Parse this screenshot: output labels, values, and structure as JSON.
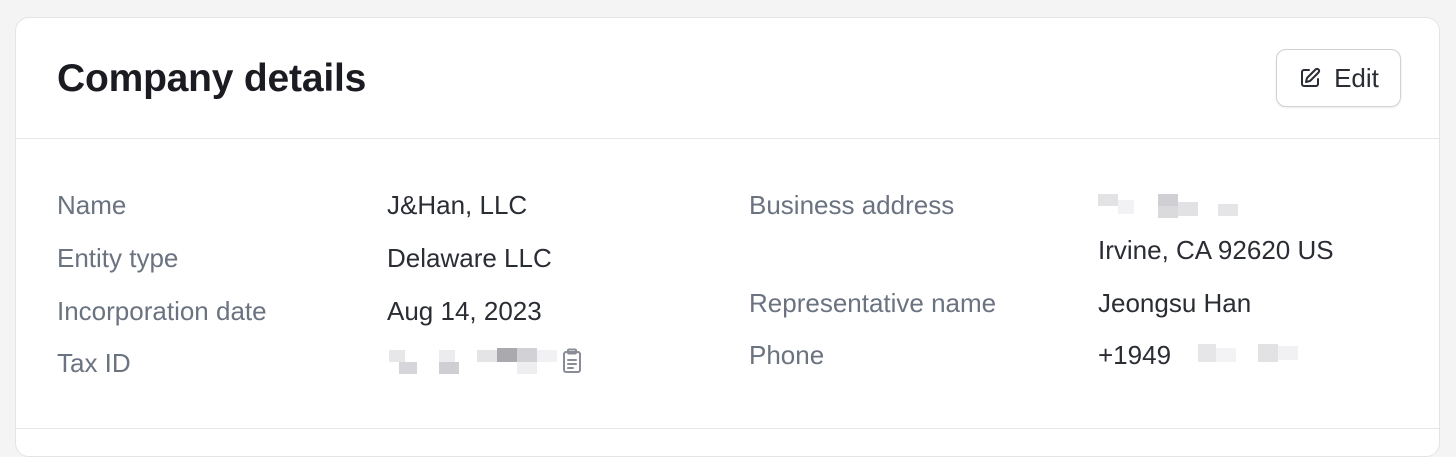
{
  "card": {
    "title": "Company details",
    "edit_label": "Edit"
  },
  "details_left": {
    "name_label": "Name",
    "name_value": "J&Han, LLC",
    "entity_label": "Entity type",
    "entity_value": "Delaware LLC",
    "incorporation_label": "Incorporation date",
    "incorporation_value": "Aug 14, 2023",
    "tax_label": "Tax ID"
  },
  "details_right": {
    "address_label": "Business address",
    "address_line2": "Irvine, CA 92620 US",
    "rep_label": "Representative name",
    "rep_value": "Jeongsu Han",
    "phone_label": "Phone",
    "phone_value": "+1949"
  },
  "icons": {
    "edit": "pencil-square-icon",
    "copy": "clipboard-icon"
  },
  "colors": {
    "label": "#6b7280",
    "value": "#2a2d34",
    "title": "#1b1b22"
  }
}
